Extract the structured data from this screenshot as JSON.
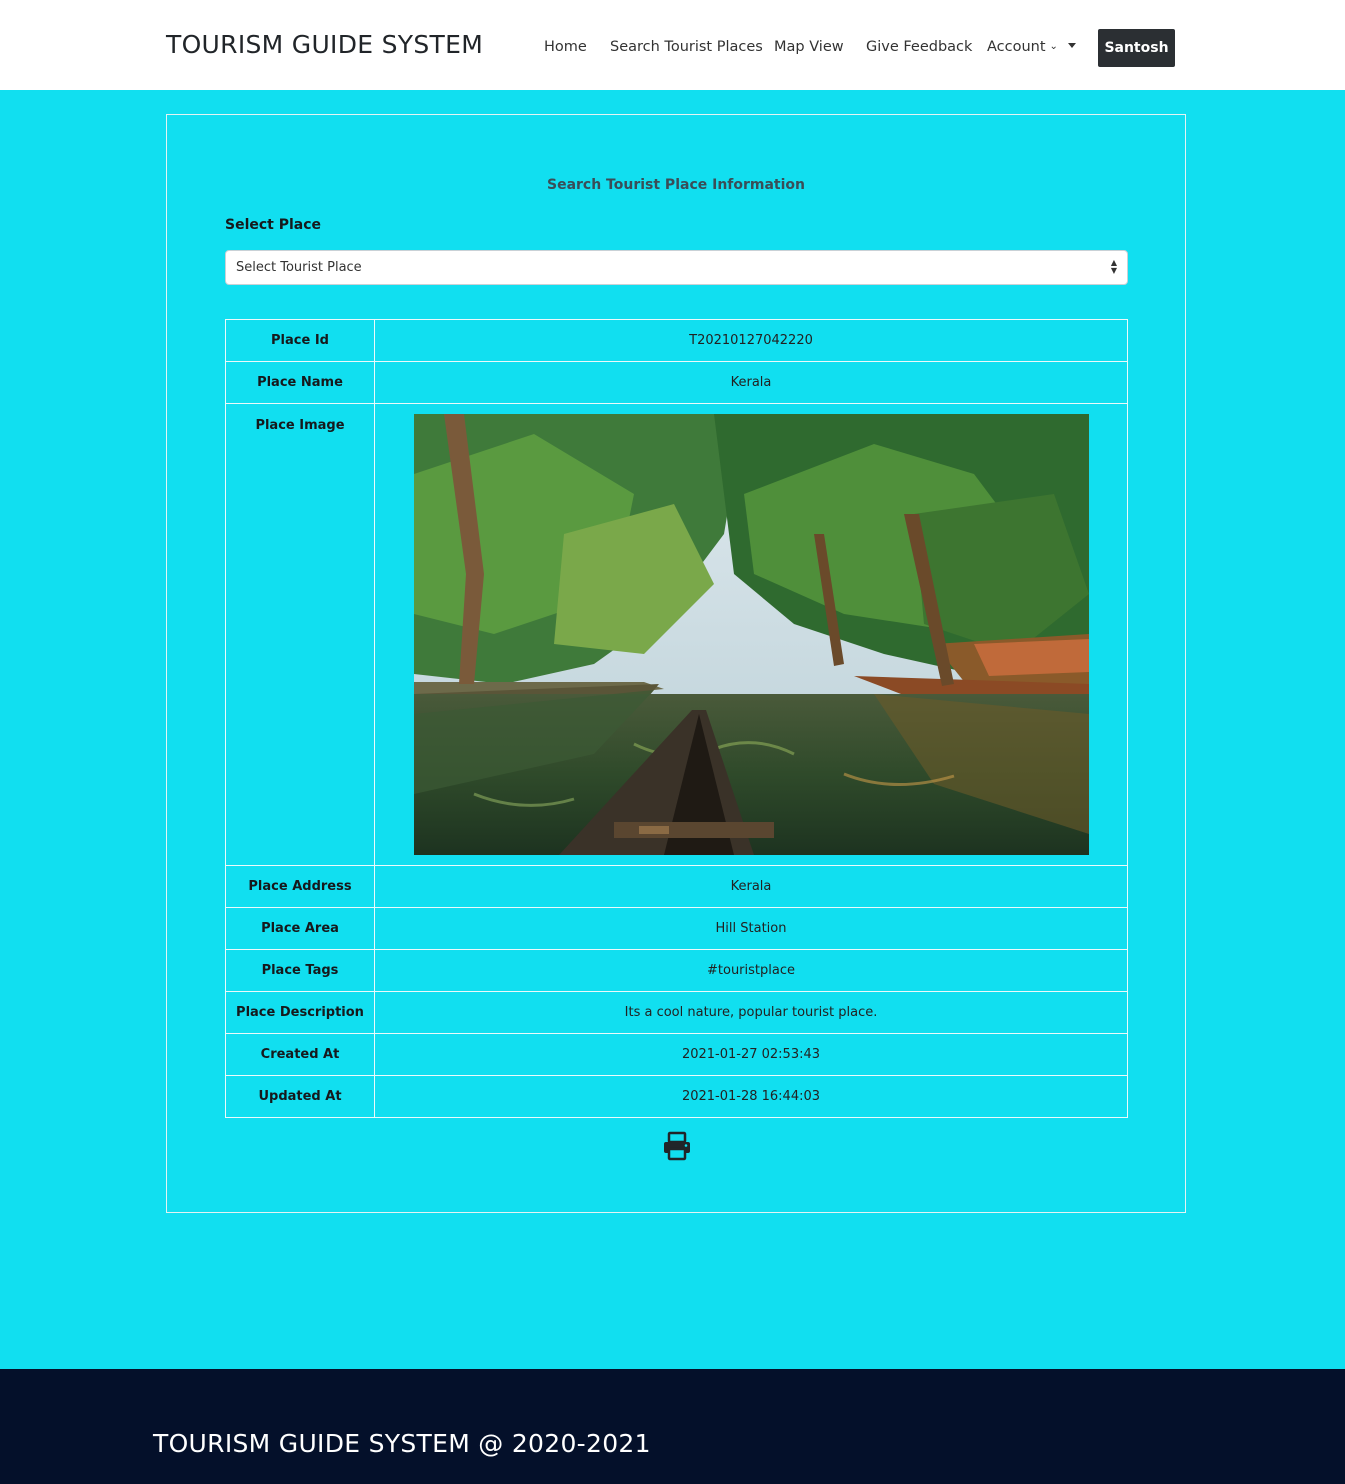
{
  "navbar": {
    "brand": "TOURISM GUIDE SYSTEM",
    "links": [
      "Home",
      "Search Tourist Places",
      "Map View",
      "Give Feedback"
    ],
    "account_label": "Account",
    "user_label": "Santosh"
  },
  "search": {
    "title": "Search Tourist Place Information",
    "select_label": "Select Place",
    "select_value": "Select Tourist Place"
  },
  "details": {
    "place_id": {
      "label": "Place Id",
      "value": "T20210127042220"
    },
    "place_name": {
      "label": "Place Name",
      "value": "Kerala"
    },
    "place_image": {
      "label": "Place Image"
    },
    "place_address": {
      "label": "Place Address",
      "value": "Kerala"
    },
    "place_area": {
      "label": "Place Area",
      "value": "Hill Station"
    },
    "place_tags": {
      "label": "Place Tags",
      "value": "#touristplace"
    },
    "place_description": {
      "label": "Place Description",
      "value": "Its a cool nature, popular tourist place."
    },
    "created_at": {
      "label": "Created At",
      "value": "2021-01-27 02:53:43"
    },
    "updated_at": {
      "label": "Updated At",
      "value": "2021-01-28 16:44:03"
    }
  },
  "icons": {
    "print": "print-icon",
    "account_caret": "chevron-down-icon",
    "dropdown": "caret-down-icon",
    "select": "select-arrows-icon"
  },
  "footer": {
    "text": "TOURISM GUIDE SYSTEM @ 2020-2021"
  },
  "colors": {
    "page_bg": "#11dff0",
    "footer_bg": "#04102a",
    "user_button_bg": "#2b2f33"
  }
}
